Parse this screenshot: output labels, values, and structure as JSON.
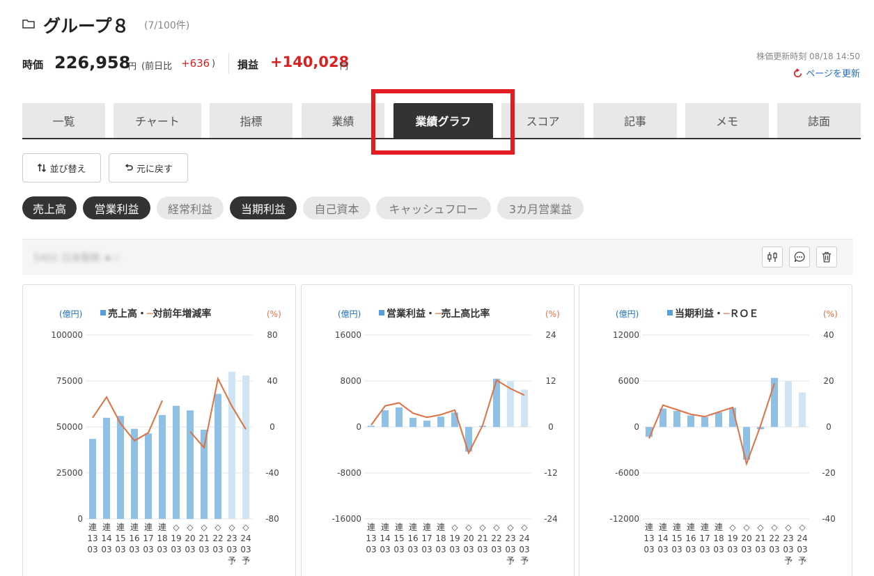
{
  "header": {
    "title": "グループ８",
    "count": "(7/100件)"
  },
  "summary": {
    "price_label": "時価",
    "price_value": "226,958",
    "price_unit": "円",
    "diff_label": "(前日比",
    "diff_value": "+636",
    "diff_close": ")",
    "pl_label": "損益",
    "pl_value": "+140,028",
    "pl_unit": "円"
  },
  "update": {
    "label": "株価更新時刻 08/18 14:50",
    "refresh_label": "ページを更新"
  },
  "tabs": [
    "一覧",
    "チャート",
    "指標",
    "業績",
    "業績グラフ",
    "スコア",
    "記事",
    "メモ",
    "誌面"
  ],
  "active_tab": "業績グラフ",
  "toolbar": {
    "sort_label": "並び替え",
    "revert_label": "元に戻す"
  },
  "filters": [
    {
      "label": "売上高",
      "on": true
    },
    {
      "label": "営業利益",
      "on": true
    },
    {
      "label": "経常利益",
      "on": false
    },
    {
      "label": "当期利益",
      "on": true
    },
    {
      "label": "自己資本",
      "on": false
    },
    {
      "label": "キャッシュフロー",
      "on": false
    },
    {
      "label": "3カ月営業益",
      "on": false
    }
  ],
  "stock": {
    "name": "5401 日本製鉄 ★☆"
  },
  "stock_icons": [
    "candlestick-icon",
    "comment-icon",
    "trash-icon"
  ],
  "colors": {
    "bar": "#8fc0e6",
    "bar_forecast": "#cfe4f4",
    "line": "#e07040",
    "accent_red": "#d92121",
    "link_blue": "#1f6fbf"
  },
  "chart_data": [
    {
      "type": "bar+line",
      "title": "売上高・対前年増減率",
      "legend_bar": "売上高",
      "legend_line": "対前年増減率",
      "left_unit": "(億円)",
      "right_unit": "(%)",
      "left_ticks": [
        "100000",
        "75000",
        "50000",
        "25000",
        "0"
      ],
      "right_ticks": [
        "80",
        "40",
        "0",
        "-40",
        "-80"
      ],
      "ylim_left": [
        0,
        100000
      ],
      "ylim_right": [
        -80,
        80
      ],
      "x_labels": [
        [
          "連",
          "13",
          "03"
        ],
        [
          "連",
          "14",
          "03"
        ],
        [
          "連",
          "15",
          "03"
        ],
        [
          "連",
          "16",
          "03"
        ],
        [
          "連",
          "17",
          "03"
        ],
        [
          "連",
          "18",
          "03"
        ],
        [
          "◇",
          "19",
          "03"
        ],
        [
          "◇",
          "20",
          "03"
        ],
        [
          "◇",
          "21",
          "03"
        ],
        [
          "◇",
          "22",
          "03"
        ],
        [
          "◇",
          "23",
          "03",
          "予"
        ],
        [
          "◇",
          "24",
          "03",
          "予"
        ]
      ],
      "bars": [
        43500,
        55000,
        56000,
        49000,
        46500,
        56500,
        61500,
        59000,
        48500,
        68000,
        80000,
        78000
      ],
      "forecast": [
        false,
        false,
        false,
        false,
        false,
        false,
        false,
        false,
        false,
        false,
        true,
        true
      ],
      "line_segments": [
        [
          [
            0,
            8
          ],
          [
            1,
            26
          ],
          [
            2,
            3
          ],
          [
            3,
            -12
          ],
          [
            4,
            -5
          ],
          [
            5,
            23
          ]
        ],
        [
          [
            7,
            -4
          ],
          [
            8,
            -18
          ],
          [
            9,
            42
          ],
          [
            10,
            18
          ],
          [
            11,
            -2
          ]
        ]
      ]
    },
    {
      "type": "bar+line",
      "title": "営業利益・売上高比率",
      "legend_bar": "営業利益",
      "legend_line": "売上高比率",
      "left_unit": "(億円)",
      "right_unit": "(%)",
      "left_ticks": [
        "16000",
        "8000",
        "0",
        "-8000",
        "-16000"
      ],
      "right_ticks": [
        "24",
        "12",
        "0",
        "-12",
        "-24"
      ],
      "ylim_left": [
        -16000,
        16000
      ],
      "ylim_right": [
        -24,
        24
      ],
      "x_labels": [
        [
          "連",
          "13",
          "03"
        ],
        [
          "連",
          "14",
          "03"
        ],
        [
          "連",
          "15",
          "03"
        ],
        [
          "連",
          "16",
          "03"
        ],
        [
          "連",
          "17",
          "03"
        ],
        [
          "連",
          "18",
          "03"
        ],
        [
          "◇",
          "19",
          "03"
        ],
        [
          "◇",
          "20",
          "03"
        ],
        [
          "◇",
          "21",
          "03"
        ],
        [
          "◇",
          "22",
          "03"
        ],
        [
          "◇",
          "23",
          "03",
          "予"
        ],
        [
          "◇",
          "24",
          "03",
          "予"
        ]
      ],
      "bars": [
        200,
        2900,
        3400,
        1600,
        1100,
        1800,
        2500,
        -4300,
        200,
        8400,
        8000,
        6500
      ],
      "forecast": [
        false,
        false,
        false,
        false,
        false,
        false,
        false,
        false,
        false,
        false,
        true,
        true
      ],
      "line_segments": [
        [
          [
            0,
            0.5
          ],
          [
            1,
            5.5
          ],
          [
            2,
            6.3
          ],
          [
            3,
            3.6
          ],
          [
            4,
            2.5
          ],
          [
            5,
            3.2
          ],
          [
            6,
            4.4
          ],
          [
            7,
            -6.8
          ],
          [
            8,
            0.4
          ],
          [
            9,
            12.2
          ],
          [
            10,
            10
          ],
          [
            11,
            8.3
          ]
        ]
      ]
    },
    {
      "type": "bar+line",
      "title": "当期利益・ＲＯＥ",
      "legend_bar": "当期利益",
      "legend_line": "ＲＯＥ",
      "left_unit": "(億円)",
      "right_unit": "(%)",
      "left_ticks": [
        "12000",
        "6000",
        "0",
        "-6000",
        "-12000"
      ],
      "right_ticks": [
        "40",
        "20",
        "0",
        "-20",
        "-40"
      ],
      "ylim_left": [
        -12000,
        12000
      ],
      "ylim_right": [
        -40,
        40
      ],
      "x_labels": [
        [
          "連",
          "13",
          "03"
        ],
        [
          "連",
          "14",
          "03"
        ],
        [
          "連",
          "15",
          "03"
        ],
        [
          "連",
          "16",
          "03"
        ],
        [
          "連",
          "17",
          "03"
        ],
        [
          "連",
          "18",
          "03"
        ],
        [
          "◇",
          "19",
          "03"
        ],
        [
          "◇",
          "20",
          "03"
        ],
        [
          "◇",
          "21",
          "03"
        ],
        [
          "◇",
          "22",
          "03"
        ],
        [
          "◇",
          "23",
          "03",
          "予"
        ],
        [
          "◇",
          "24",
          "03",
          "予"
        ]
      ],
      "bars": [
        -1300,
        2400,
        2100,
        1500,
        1300,
        1900,
        2500,
        -4300,
        -300,
        6400,
        6000,
        4500
      ],
      "forecast": [
        false,
        false,
        false,
        false,
        false,
        false,
        false,
        false,
        false,
        false,
        true,
        true
      ],
      "line_segments": [
        [
          [
            0,
            -5
          ],
          [
            1,
            9.5
          ],
          [
            2,
            7.5
          ],
          [
            3,
            5.5
          ],
          [
            4,
            4.5
          ],
          [
            5,
            6.5
          ],
          [
            6,
            8.5
          ],
          [
            7,
            -16
          ],
          [
            8,
            0.5
          ],
          [
            9,
            19
          ]
        ]
      ]
    }
  ]
}
